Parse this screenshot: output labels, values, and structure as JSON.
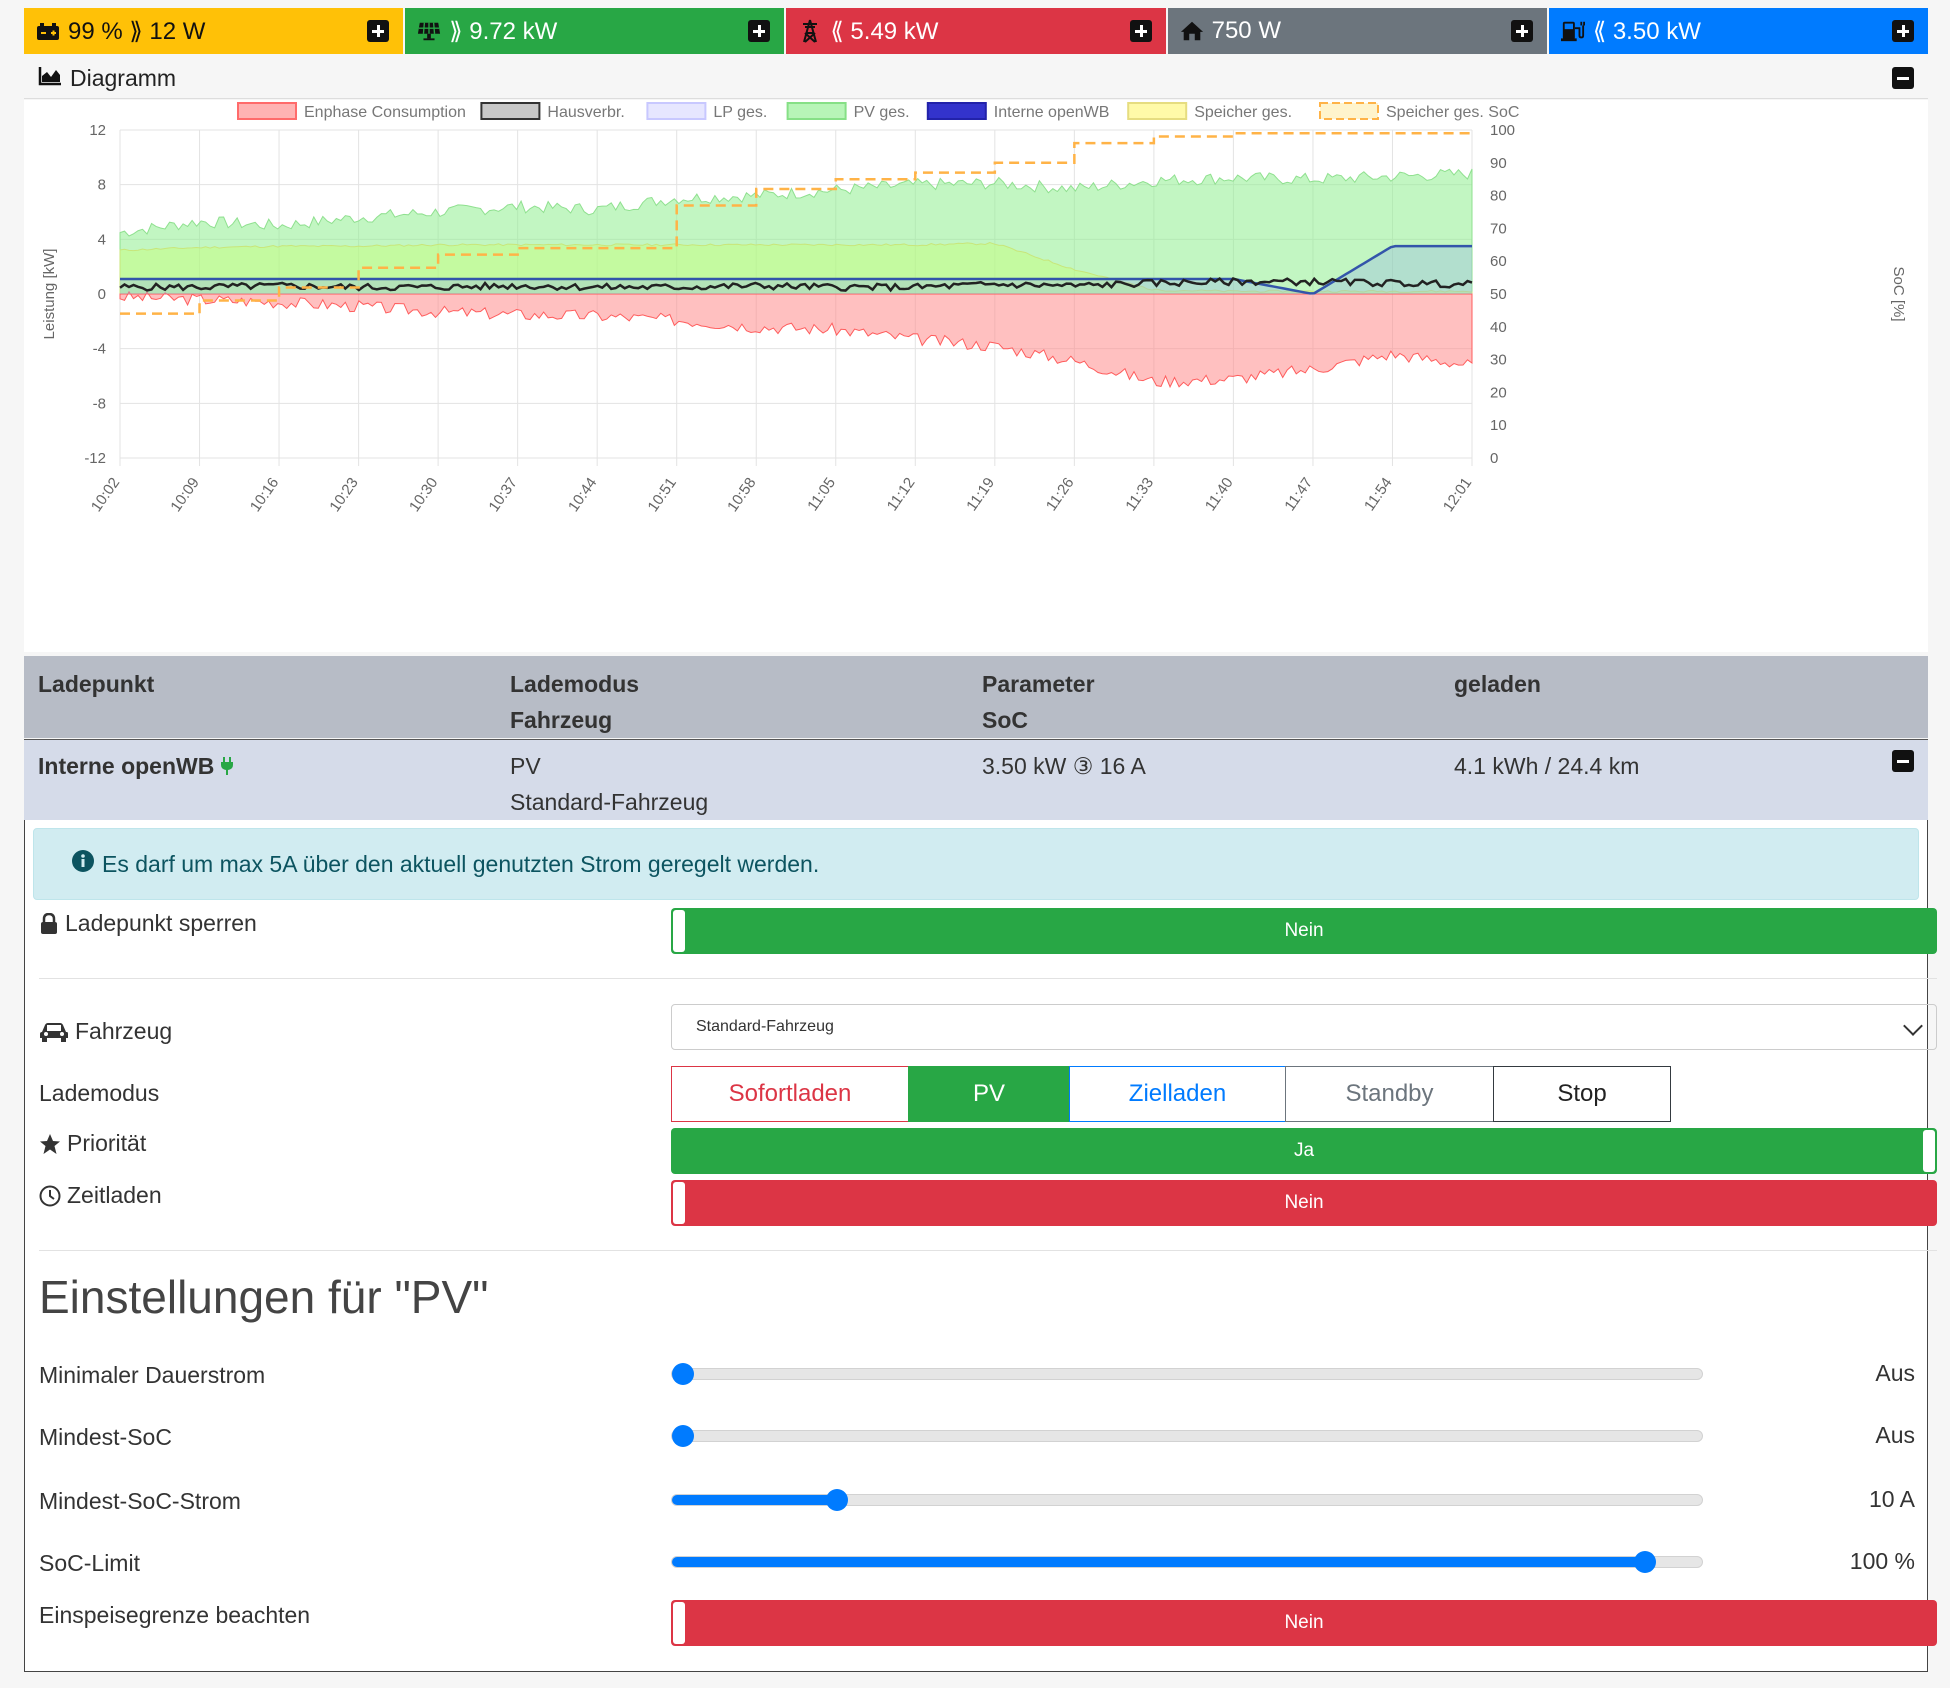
{
  "topbar": [
    {
      "icon": "car-battery-icon",
      "text": "99 % ⟫ 12 W",
      "bg": "#ffc107",
      "color": "#111"
    },
    {
      "icon": "solar-panel-icon",
      "text": "⟫ 9.72 kW",
      "bg": "#28a745",
      "color": "#fff"
    },
    {
      "icon": "power-pylon-icon",
      "text": "⟪ 5.49 kW",
      "bg": "#dc3545",
      "color": "#fff"
    },
    {
      "icon": "house-icon",
      "text": "750 W",
      "bg": "#6c757d",
      "color": "#fff"
    },
    {
      "icon": "charging-station-icon",
      "text": "⟪ 3.50 kW",
      "bg": "#007bff",
      "color": "#fff"
    }
  ],
  "diagram": {
    "title": "Diagramm"
  },
  "chart_data": {
    "type": "area",
    "legend": [
      "Enphase Consumption",
      "Hausverbr.",
      "LP ges.",
      "PV ges.",
      "Interne openWB",
      "Speicher ges.",
      "Speicher ges. SoC"
    ],
    "legend_position": "top",
    "ylabel": "Leistung [kW]",
    "y2label": "SoC [%]",
    "ylim": [
      -12,
      12
    ],
    "y2lim": [
      0,
      100
    ],
    "yticks": [
      "12",
      "8",
      "4",
      "0",
      "-4",
      "-8",
      "-12"
    ],
    "y2ticks": [
      "100",
      "90",
      "80",
      "70",
      "60",
      "50",
      "40",
      "30",
      "20",
      "10",
      "0"
    ],
    "xticks": [
      "10:02",
      "10:09",
      "10:16",
      "10:23",
      "10:30",
      "10:37",
      "10:44",
      "10:51",
      "10:58",
      "11:05",
      "11:12",
      "11:19",
      "11:26",
      "11:33",
      "11:40",
      "11:47",
      "11:54",
      "12:01"
    ],
    "series": [
      {
        "name": "PV ges.",
        "color": "#90ee90",
        "values": [
          4.5,
          5.3,
          5.0,
          5.6,
          6.0,
          6.4,
          6.2,
          7.0,
          7.2,
          7.6,
          8.0,
          8.1,
          7.7,
          8.3,
          8.5,
          8.4,
          8.6,
          8.8
        ]
      },
      {
        "name": "Speicher ges.",
        "color": "#fffc9e",
        "values": [
          3.2,
          3.4,
          3.5,
          3.5,
          3.6,
          3.6,
          3.6,
          3.6,
          3.6,
          3.6,
          3.6,
          3.7,
          1.8,
          0.3,
          0.2,
          0.2,
          0.2,
          0.2
        ]
      },
      {
        "name": "Enphase Consumption",
        "color": "#ff9d9d",
        "values": [
          -0.2,
          -0.4,
          -0.6,
          -0.9,
          -1.3,
          -1.5,
          -1.6,
          -1.9,
          -2.4,
          -2.6,
          -3.3,
          -3.8,
          -4.9,
          -6.4,
          -6.2,
          -5.5,
          -4.4,
          -5.2
        ]
      },
      {
        "name": "Interne openWB",
        "color": "#3333cc",
        "values": [
          1.1,
          1.1,
          1.1,
          1.1,
          1.1,
          1.1,
          1.1,
          1.1,
          1.1,
          1.1,
          1.1,
          1.1,
          1.1,
          1.1,
          1.1,
          0.0,
          3.5,
          3.5
        ]
      },
      {
        "name": "Hausverbr.",
        "color": "#222222",
        "values": [
          0.5,
          0.5,
          0.6,
          0.5,
          0.5,
          0.6,
          0.5,
          0.5,
          0.6,
          0.5,
          0.5,
          0.7,
          0.6,
          0.8,
          0.9,
          0.9,
          0.8,
          0.7
        ]
      },
      {
        "name": "Speicher ges. SoC",
        "color": "#ffa500",
        "values": [
          44,
          48,
          52,
          58,
          62,
          64,
          64,
          77,
          82,
          85,
          87,
          90,
          96,
          98,
          99,
          99,
          99,
          99
        ]
      }
    ]
  },
  "lp_table": {
    "headers": [
      [
        "Ladepunkt",
        ""
      ],
      [
        "Lademodus",
        "Fahrzeug"
      ],
      [
        "Parameter",
        "SoC"
      ],
      [
        "geladen",
        ""
      ]
    ],
    "row": {
      "name": "Interne openWB",
      "mode": "PV",
      "vehicle": "Standard-Fahrzeug",
      "parameter": "3.50 kW ③ 16 A",
      "charged": "4.1 kWh / 24.4 km"
    }
  },
  "panel": {
    "info": "Es darf um max 5A über den aktuell genutzten Strom geregelt werden.",
    "lock_label": "Ladepunkt sperren",
    "lock_value": "Nein",
    "vehicle_label": "Fahrzeug",
    "vehicle_value": "Standard-Fahrzeug",
    "mode_label": "Lademodus",
    "modes": [
      "Sofortladen",
      "PV",
      "Zielladen",
      "Standby",
      "Stop"
    ],
    "priority_label": "Priorität",
    "priority_value": "Ja",
    "timed_label": "Zeitladen",
    "timed_value": "Nein",
    "settings_title": "Einstellungen für \"PV\"",
    "sliders": [
      {
        "label": "Minimaler Dauerstrom",
        "value": "Aus",
        "level": 0
      },
      {
        "label": "Mindest-SoC",
        "value": "Aus",
        "level": 0
      },
      {
        "label": "Mindest-SoC-Strom",
        "value": "10 A",
        "level": 0.16
      },
      {
        "label": "SoC-Limit",
        "value": "100 %",
        "level": 0.945
      }
    ],
    "feedin_label": "Einspeisegrenze beachten",
    "feedin_value": "Nein"
  }
}
